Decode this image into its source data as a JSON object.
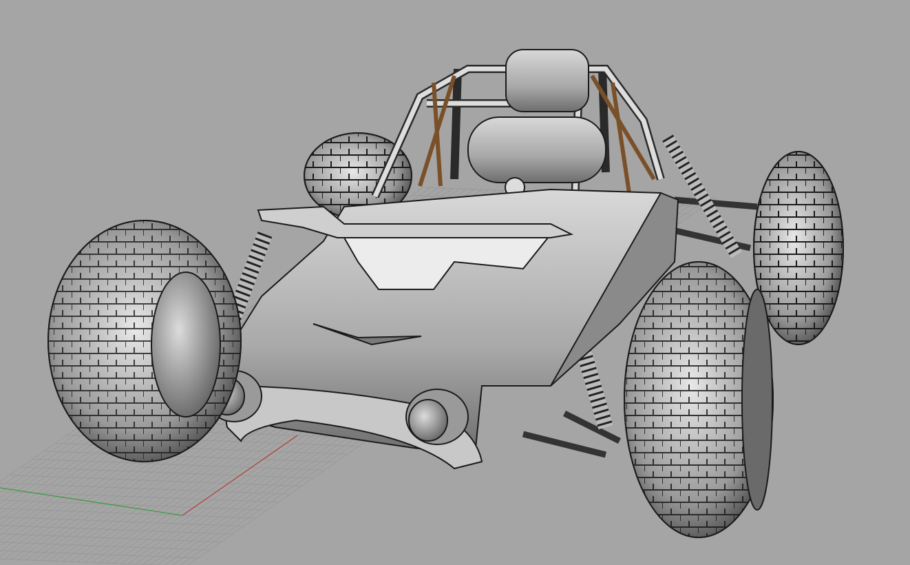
{
  "viewport": {
    "mode": "shaded-perspective",
    "colors": {
      "background": "#a5a5a5",
      "grid_line": "#9a9a9a",
      "x_axis": "#b0403a",
      "y_axis": "#3f9a48",
      "model_light": "#f2f2f2",
      "model_mid": "#bdbdbd",
      "model_dark": "#5a5a5a",
      "edge": "#1a1a1a",
      "strap": "#8a6030"
    }
  }
}
